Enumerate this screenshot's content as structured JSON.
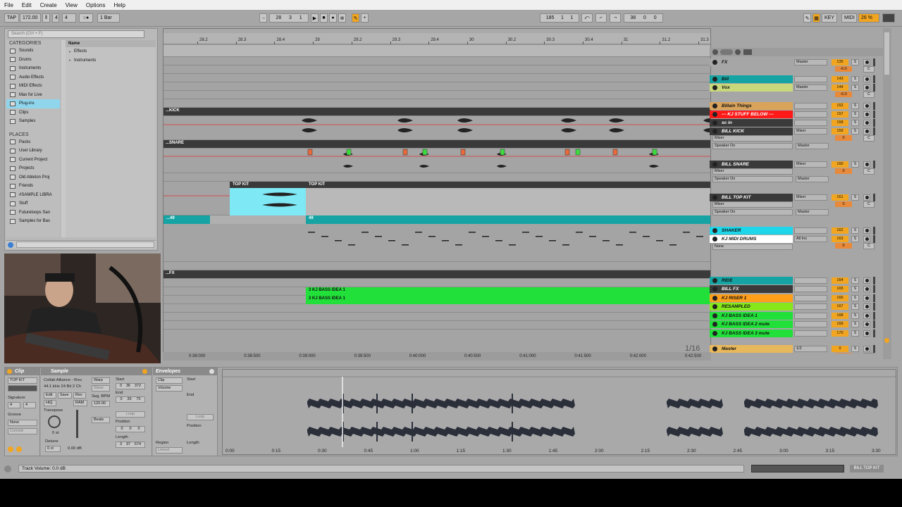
{
  "menu": [
    "File",
    "Edit",
    "Create",
    "View",
    "Options",
    "Help"
  ],
  "transport": {
    "tap": "TAP",
    "tempo": "172.00",
    "sig_num": "4",
    "sig_den": "4",
    "quant": "1 Bar",
    "position": [
      "28",
      "3",
      "1"
    ],
    "loop_start": [
      "185",
      "1",
      "1"
    ],
    "loop_len": [
      "38",
      "0",
      "0"
    ],
    "key": "KEY",
    "midi": "MIDI",
    "cpu": "26 %"
  },
  "browser": {
    "search_placeholder": "Search (Ctrl + F)",
    "categories_title": "CATEGORIES",
    "categories": [
      "Sounds",
      "Drums",
      "Instruments",
      "Audio Effects",
      "MIDI Effects",
      "Max for Live",
      "Plug-ins",
      "Clips",
      "Samples"
    ],
    "selected": "Plug-ins",
    "places_title": "PLACES",
    "places": [
      "Packs",
      "User Library",
      "Current Project",
      "Projects",
      "Old Ableton Proj",
      "Friends",
      "#SAMPLE LIBRA",
      "Stuff",
      "Futureloops San",
      "Samples for Bas"
    ],
    "name_header": "Name",
    "items": [
      "Effects",
      "Instruments"
    ]
  },
  "ruler": [
    "28.2",
    "28.3",
    "28.4",
    "29",
    "29.2",
    "29.3",
    "29.4",
    "30",
    "30.2",
    "30.3",
    "30.4",
    "31",
    "31.2",
    "31.3"
  ],
  "time_ruler": [
    "0:38:000",
    "0:38:500",
    "0:39:000",
    "0:39:500",
    "0:40:000",
    "0:40:500",
    "0:41:000",
    "0:41:500",
    "0:42:000",
    "0:42:500"
  ],
  "zoom": "1/16",
  "arr_clips": {
    "kick_group": "...KICK",
    "snare_group": "...SNARE",
    "fx_group": "...FX",
    "topkit_a": "TOP KIT",
    "topkit_b": "TOP KIT",
    "midi_a": "...49",
    "midi_b": "49",
    "bass1": "3 KJ BASS IDEA 1",
    "bass2": "3 KJ BASS IDEA 1",
    "marker": "J"
  },
  "tracks": [
    {
      "name": "FX",
      "color": "#a6a6a6",
      "route": "Master",
      "num": "135",
      "vol": "-6.0"
    },
    {
      "name": "Bill",
      "color": "#16a3a3",
      "route": "",
      "num": "143",
      "vol": ""
    },
    {
      "name": "Vox",
      "color": "#c8d87a",
      "route": "Master",
      "num": "144",
      "vol": "-6.0"
    },
    {
      "name": "Billain Things",
      "color": "#d9a35a",
      "route": "",
      "num": "152",
      "vol": ""
    },
    {
      "name": "--- KJ STUFF BELOW ---",
      "color": "#ff1a1a",
      "route": "",
      "num": "157",
      "vol": ""
    },
    {
      "name": "sc in",
      "color": "#3a3a3a",
      "route": "",
      "num": "158",
      "vol": ""
    },
    {
      "name": "BILL KICK",
      "color": "#3a3a3a",
      "route": "Mixer",
      "num": "159",
      "vol": "0"
    },
    {
      "name": "BILL SNARE",
      "color": "#3a3a3a",
      "route": "Mixer",
      "num": "160",
      "vol": "0"
    },
    {
      "name": "BILL TOP KIT",
      "color": "#3a3a3a",
      "route": "Mixer",
      "num": "161",
      "vol": "0"
    },
    {
      "name": "SHAKER",
      "color": "#1ed6ea",
      "route": "",
      "num": "162",
      "vol": ""
    },
    {
      "name": "KJ MIDI DRUMS",
      "color": "#ffffff",
      "route": "All Ins",
      "num": "163",
      "vol": "0"
    },
    {
      "name": "RIDE",
      "color": "#16a3a3",
      "route": "",
      "num": "164",
      "vol": ""
    },
    {
      "name": "BILL FX",
      "color": "#3a3a3a",
      "route": "",
      "num": "165",
      "vol": ""
    },
    {
      "name": "KJ RISER 1",
      "color": "#ff9f1a",
      "route": "",
      "num": "166",
      "vol": ""
    },
    {
      "name": "RESAMPLED",
      "color": "#86e81b",
      "route": "",
      "num": "167",
      "vol": ""
    },
    {
      "name": "KJ BASS IDEA 1",
      "color": "#22e03a",
      "route": "",
      "num": "168",
      "vol": ""
    },
    {
      "name": "KJ BASS IDEA 2 mute",
      "color": "#22e03a",
      "route": "",
      "num": "169",
      "vol": ""
    },
    {
      "name": "KJ BASS IDEA 3 mute",
      "color": "#22e03a",
      "route": "",
      "num": "170",
      "vol": ""
    },
    {
      "name": "Master",
      "color": "#e8b85c",
      "route": "1/2",
      "num": "0",
      "vol": "4.0"
    }
  ],
  "sub_routes": {
    "mixer": "Mixer",
    "speaker": "Speaker On",
    "master": "Master",
    "none": "None",
    "allch": "All Channels",
    "auto": "Auto",
    "in": "In",
    "off": "Off"
  },
  "solo": "S",
  "cue": "C",
  "detail": {
    "clip_title": "Clip",
    "clip_name": "TOP KIT",
    "signature_label": "Signature",
    "sig_num": "4",
    "sig_den": "4",
    "groove_label": "Groove",
    "groove_val": "None",
    "commit": "Commit",
    "sample_title": "Sample",
    "sample_name": "Collab Alliance - Rou",
    "sample_info": "44.1 kHz 24 Bit 2 Ch",
    "edit": "Edit",
    "save": "Save",
    "rev": "Rev",
    "hiq": "HiQ",
    "ram": "RAM",
    "transpose_label": "Transpose",
    "transpose_val": "0 st",
    "detune_label": "Detune",
    "detune_val": "0 ct",
    "gain": "0.00 dB",
    "warp": "Warp",
    "slave": "Slave",
    "segbpm_label": "Seg. BPM",
    "segbpm": "120.00",
    "beats": "Beats",
    "start_label": "Start",
    "start_val": [
      "0",
      "36",
      "372"
    ],
    "end_label": "End",
    "end_val": [
      "0",
      "39",
      "70"
    ],
    "loop": "Loop",
    "position_label": "Position",
    "pos_val": [
      "0",
      "0",
      "0"
    ],
    "length_label": "Length",
    "len_val": [
      "3",
      "37",
      "674"
    ],
    "set": "Set",
    "envelopes_title": "Envelopes",
    "env_clip": "Clip",
    "env_volume": "Volume",
    "env_start": "Start",
    "env_end": "End",
    "env_loop": "Loop",
    "env_position": "Position",
    "env_length": "Length",
    "region": "Region",
    "linked": "Linked",
    "wave_ticks": [
      "0:00",
      "0:15",
      "0:30",
      "0:45",
      "1:00",
      "1:15",
      "1:30",
      "1:45",
      "2:00",
      "2:15",
      "2:30",
      "2:45",
      "3:00",
      "3:15",
      "3:30"
    ]
  },
  "status": {
    "text": "Track Volume: 0.0 dB",
    "right": "BILL TOP KIT"
  },
  "colors": {
    "orange": "#f1a520",
    "cyan": "#8fd5ec",
    "green": "#22e03a",
    "teal": "#16a3a3",
    "red": "#ff1a1a"
  }
}
